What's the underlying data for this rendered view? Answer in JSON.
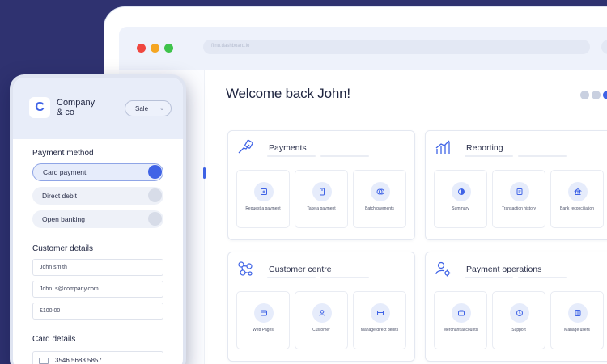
{
  "browser": {
    "url": "fiinu.dashboard.io"
  },
  "dashboard": {
    "welcome": "Welcome back John!",
    "sections": [
      {
        "title": "Payments",
        "tiles": [
          "Request a payment",
          "Take a payment",
          "Batch payments"
        ]
      },
      {
        "title": "Reporting",
        "tiles": [
          "Summary",
          "Transaction history",
          "Bank reconciliation"
        ]
      },
      {
        "title": "Customer centre",
        "tiles": [
          "Web Pages",
          "Customer",
          "Manage direct debits"
        ]
      },
      {
        "title": "Payment operations",
        "tiles": [
          "Merchant accounts",
          "Support",
          "Manage users"
        ]
      }
    ]
  },
  "phone": {
    "logo_letter": "C",
    "company_line1": "Company",
    "company_line2": "& co",
    "dropdown": "Sale",
    "payment_method_label": "Payment method",
    "options": [
      {
        "label": "Card payment",
        "selected": true
      },
      {
        "label": "Direct debit",
        "selected": false
      },
      {
        "label": "Open banking",
        "selected": false
      }
    ],
    "customer_details_label": "Customer details",
    "fields": {
      "name": "John smith",
      "email": "John. s@company.com",
      "amount": "£100.00"
    },
    "card_details_label": "Card details",
    "card_number": "3546 5683 5857"
  },
  "colors": {
    "background": "#2f3270",
    "accent": "#3f63e6",
    "red": "#f0473f",
    "orange": "#f5a622",
    "green": "#3fc34b"
  }
}
